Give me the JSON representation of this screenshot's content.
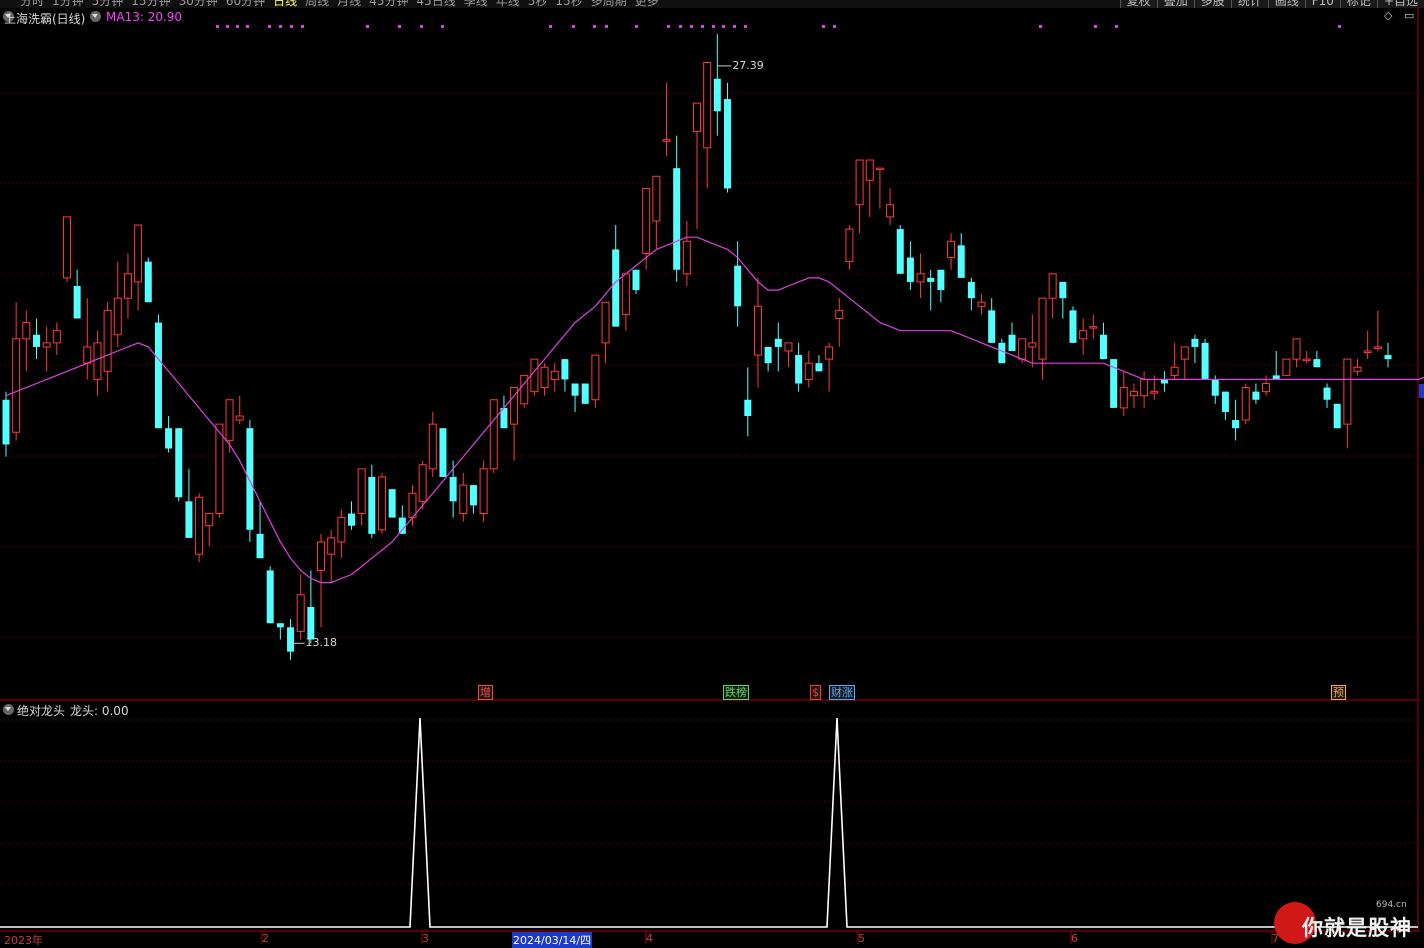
{
  "toolbar": {
    "period_tabs": [
      "分时",
      "1分钟",
      "5分钟",
      "15分钟",
      "30分钟",
      "60分钟",
      "日线",
      "周线",
      "月线",
      "45分钟",
      "45日线",
      "季线",
      "年线",
      "5秒",
      "15秒",
      "多周期",
      "更多"
    ],
    "active_tab": "日线",
    "right_buttons": [
      "复权",
      "叠加",
      "多股",
      "统计",
      "画线",
      "F10",
      "标记",
      "+自选"
    ]
  },
  "chart": {
    "symbol_title": "上海洗霸(日线)",
    "ma_label": "MA13: 20.90",
    "high_marker": "27.39",
    "low_marker": "13.18"
  },
  "signals": [
    {
      "label": "增",
      "color": "#ff4444"
    },
    {
      "label": "跌榜",
      "color": "#55dd55"
    },
    {
      "label": "$",
      "color": "#ff3333"
    },
    {
      "label": "财涨",
      "color": "#55aaff"
    },
    {
      "label": "预",
      "color": "#ffaa33"
    }
  ],
  "indicator": {
    "title": "绝对龙头",
    "value_label": "龙头: 0.00"
  },
  "dates": {
    "labels": [
      "2023年",
      "2",
      "3",
      "4",
      "5",
      "6",
      "7"
    ],
    "selected": "2024/03/14/四"
  },
  "watermark": {
    "text": "你就是股神",
    "small": "694.cn"
  },
  "colors": {
    "up": "#ff3a3a",
    "down": "#54ffff",
    "ma": "#e040e0",
    "grid": "#7a0000",
    "background": "#000000",
    "indicator": "#ffffff"
  },
  "chart_data": {
    "type": "candlestick",
    "title": "上海洗霸(日线)",
    "series_ma": {
      "name": "MA13",
      "last": 20.9
    },
    "ohlc": [
      [
        19.1,
        19.3,
        17.7,
        18.0
      ],
      [
        18.3,
        21.5,
        18.1,
        20.6
      ],
      [
        20.6,
        21.3,
        19.8,
        21.0
      ],
      [
        20.7,
        21.1,
        20.1,
        20.4
      ],
      [
        20.4,
        20.9,
        19.8,
        20.5
      ],
      [
        20.5,
        21.0,
        20.2,
        20.8
      ],
      [
        22.1,
        23.2,
        22.0,
        23.6
      ],
      [
        21.9,
        22.3,
        21.1,
        21.1
      ],
      [
        20.0,
        21.6,
        19.6,
        20.4
      ],
      [
        19.6,
        20.8,
        19.2,
        20.5
      ],
      [
        19.8,
        21.5,
        19.3,
        21.3
      ],
      [
        20.7,
        22.5,
        20.4,
        21.6
      ],
      [
        21.6,
        22.7,
        21.1,
        22.2
      ],
      [
        22.0,
        23.3,
        21.3,
        23.4
      ],
      [
        22.5,
        22.6,
        21.7,
        21.5
      ],
      [
        21.0,
        21.2,
        18.8,
        18.4
      ],
      [
        18.4,
        18.7,
        17.8,
        17.9
      ],
      [
        18.4,
        18.4,
        16.6,
        16.7
      ],
      [
        16.6,
        17.4,
        15.8,
        15.7
      ],
      [
        15.3,
        16.8,
        15.1,
        16.7
      ],
      [
        16.0,
        16.3,
        15.5,
        16.3
      ],
      [
        16.3,
        18.3,
        16.2,
        18.5
      ],
      [
        18.1,
        19.0,
        17.8,
        19.1
      ],
      [
        18.6,
        19.2,
        18.5,
        18.7
      ],
      [
        18.4,
        18.6,
        15.6,
        15.9
      ],
      [
        15.8,
        16.6,
        15.3,
        15.2
      ],
      [
        14.9,
        15.0,
        13.7,
        13.6
      ],
      [
        13.6,
        13.6,
        13.2,
        13.5
      ],
      [
        13.5,
        13.7,
        12.7,
        12.9
      ],
      [
        13.4,
        14.8,
        13.2,
        14.3
      ],
      [
        14.0,
        14.9,
        13.1,
        13.2
      ],
      [
        14.9,
        15.8,
        13.5,
        15.6
      ],
      [
        15.3,
        15.9,
        14.6,
        15.7
      ],
      [
        15.6,
        16.4,
        15.2,
        16.2
      ],
      [
        16.3,
        16.6,
        15.9,
        16.0
      ],
      [
        16.3,
        17.2,
        16.0,
        17.4
      ],
      [
        17.2,
        17.5,
        15.7,
        15.8
      ],
      [
        15.9,
        17.3,
        15.8,
        17.2
      ],
      [
        16.9,
        16.9,
        16.2,
        16.2
      ],
      [
        16.2,
        16.5,
        15.8,
        15.8
      ],
      [
        16.2,
        17.0,
        16.0,
        16.8
      ],
      [
        16.6,
        17.6,
        16.4,
        17.5
      ],
      [
        17.4,
        18.8,
        17.2,
        18.5
      ],
      [
        18.4,
        18.4,
        18.5,
        17.2
      ],
      [
        17.2,
        17.6,
        16.2,
        16.6
      ],
      [
        16.3,
        17.3,
        16.1,
        17.0
      ],
      [
        17.0,
        17.0,
        16.3,
        16.5
      ],
      [
        16.3,
        17.6,
        16.1,
        17.4
      ],
      [
        17.4,
        19.0,
        17.3,
        19.1
      ],
      [
        18.9,
        19.2,
        18.5,
        18.4
      ],
      [
        18.5,
        19.3,
        17.6,
        19.4
      ],
      [
        19.0,
        19.4,
        18.9,
        19.7
      ],
      [
        19.3,
        19.9,
        19.2,
        20.1
      ],
      [
        19.4,
        20.0,
        19.2,
        19.9
      ],
      [
        19.6,
        20.0,
        19.3,
        19.8
      ],
      [
        20.1,
        20.0,
        19.3,
        19.6
      ],
      [
        19.5,
        19.4,
        18.8,
        19.2
      ],
      [
        19.5,
        19.5,
        19.0,
        19.0
      ],
      [
        19.1,
        20.2,
        18.9,
        20.2
      ],
      [
        20.5,
        21.5,
        20.0,
        21.5
      ],
      [
        22.8,
        23.4,
        20.9,
        20.9
      ],
      [
        21.2,
        22.2,
        20.8,
        22.2
      ],
      [
        22.3,
        22.1,
        21.7,
        21.8
      ],
      [
        22.7,
        24.3,
        22.3,
        24.3
      ],
      [
        23.5,
        24.6,
        22.8,
        24.6
      ],
      [
        25.5,
        26.9,
        25.1,
        25.5
      ],
      [
        24.8,
        25.6,
        22.0,
        22.3
      ],
      [
        22.2,
        23.5,
        21.9,
        23.0
      ],
      [
        25.7,
        26.2,
        23.3,
        26.4
      ],
      [
        25.3,
        26.7,
        24.3,
        27.4
      ],
      [
        27.0,
        28.1,
        25.6,
        26.2
      ],
      [
        26.5,
        26.9,
        24.2,
        24.3
      ],
      [
        22.4,
        23.0,
        20.9,
        21.4
      ],
      [
        19.1,
        19.9,
        18.2,
        18.7
      ],
      [
        20.2,
        22.1,
        19.4,
        21.4
      ],
      [
        20.4,
        20.4,
        19.8,
        20.0
      ],
      [
        20.6,
        21.0,
        19.8,
        20.4
      ],
      [
        20.3,
        20.5,
        19.9,
        20.5
      ],
      [
        20.2,
        20.5,
        19.3,
        19.5
      ],
      [
        19.6,
        20.3,
        19.4,
        20.0
      ],
      [
        20.0,
        20.2,
        19.9,
        19.8
      ],
      [
        20.1,
        20.5,
        19.3,
        20.4
      ],
      [
        21.1,
        21.6,
        20.4,
        21.3
      ],
      [
        22.5,
        23.4,
        22.3,
        23.3
      ],
      [
        23.9,
        24.2,
        23.2,
        25.0
      ],
      [
        24.5,
        25.0,
        23.6,
        25.0
      ],
      [
        24.8,
        24.7,
        23.8,
        24.8
      ],
      [
        23.6,
        24.3,
        23.4,
        23.9
      ],
      [
        23.3,
        23.4,
        22.2,
        22.2
      ],
      [
        22.6,
        23.0,
        21.8,
        22.0
      ],
      [
        22.0,
        22.7,
        21.6,
        22.2
      ],
      [
        22.1,
        22.3,
        21.3,
        22.0
      ],
      [
        22.3,
        22.3,
        21.5,
        21.8
      ],
      [
        22.6,
        23.2,
        22.3,
        23.0
      ],
      [
        22.9,
        23.2,
        22.6,
        22.1
      ],
      [
        22.0,
        22.1,
        21.3,
        21.6
      ],
      [
        21.4,
        21.7,
        21.2,
        21.5
      ],
      [
        21.3,
        21.6,
        21.0,
        20.5
      ],
      [
        20.5,
        20.6,
        20.0,
        20.0
      ],
      [
        20.7,
        21.0,
        20.4,
        20.3
      ],
      [
        20.1,
        20.6,
        20.0,
        20.6
      ],
      [
        20.4,
        21.2,
        19.9,
        20.5
      ],
      [
        20.1,
        20.8,
        19.6,
        21.6
      ],
      [
        21.6,
        22.2,
        21.1,
        22.2
      ],
      [
        22.0,
        22.0,
        21.1,
        21.6
      ],
      [
        21.3,
        21.4,
        21.1,
        20.5
      ],
      [
        20.6,
        21.1,
        20.2,
        20.8
      ],
      [
        20.9,
        21.2,
        20.6,
        20.9
      ],
      [
        20.7,
        21.0,
        20.4,
        20.1
      ],
      [
        20.1,
        20.0,
        19.7,
        18.9
      ],
      [
        18.9,
        19.8,
        18.7,
        19.4
      ],
      [
        19.2,
        19.5,
        18.9,
        19.3
      ],
      [
        19.2,
        19.8,
        18.9,
        19.6
      ],
      [
        19.3,
        19.7,
        19.1,
        19.3
      ],
      [
        19.6,
        19.8,
        19.3,
        19.5
      ],
      [
        19.7,
        20.5,
        19.6,
        19.9
      ],
      [
        20.1,
        20.3,
        19.6,
        20.4
      ],
      [
        20.6,
        20.7,
        20.0,
        20.4
      ],
      [
        20.5,
        20.6,
        19.6,
        19.6
      ],
      [
        19.6,
        19.7,
        19.0,
        19.2
      ],
      [
        19.3,
        19.3,
        18.6,
        18.8
      ],
      [
        18.6,
        19.1,
        18.1,
        18.4
      ],
      [
        18.6,
        19.5,
        18.5,
        19.4
      ],
      [
        19.3,
        19.5,
        19.0,
        19.1
      ],
      [
        19.3,
        19.7,
        19.2,
        19.5
      ],
      [
        19.7,
        20.3,
        19.6,
        19.6
      ],
      [
        19.7,
        20.1,
        19.7,
        20.1
      ],
      [
        20.1,
        20.6,
        19.9,
        20.6
      ],
      [
        20.1,
        20.3,
        20.0,
        20.1
      ],
      [
        20.1,
        20.3,
        20.0,
        19.9
      ],
      [
        19.4,
        19.5,
        18.9,
        19.1
      ],
      [
        19.0,
        19.0,
        18.6,
        18.4
      ],
      [
        18.5,
        20.0,
        17.9,
        20.1
      ],
      [
        19.8,
        20.1,
        19.7,
        19.9
      ],
      [
        20.3,
        20.8,
        20.1,
        20.3
      ],
      [
        20.4,
        21.3,
        20.3,
        20.4
      ],
      [
        20.2,
        20.5,
        19.9,
        20.1
      ]
    ],
    "ma13_values": [
      19.2,
      19.3,
      19.4,
      19.5,
      19.6,
      19.7,
      19.8,
      19.9,
      20.0,
      20.1,
      20.2,
      20.3,
      20.4,
      20.5,
      20.4,
      20.1,
      19.8,
      19.5,
      19.2,
      18.9,
      18.6,
      18.3,
      18.0,
      17.6,
      17.1,
      16.6,
      16.1,
      15.6,
      15.2,
      14.9,
      14.7,
      14.6,
      14.6,
      14.7,
      14.8,
      15.0,
      15.2,
      15.4,
      15.6,
      15.9,
      16.2,
      16.5,
      16.8,
      17.1,
      17.4,
      17.7,
      18.0,
      18.3,
      18.6,
      18.9,
      19.2,
      19.5,
      19.8,
      20.1,
      20.4,
      20.7,
      21.0,
      21.2,
      21.4,
      21.7,
      22.0,
      22.2,
      22.4,
      22.6,
      22.8,
      22.9,
      23.0,
      23.1,
      23.1,
      23.0,
      22.9,
      22.8,
      22.6,
      22.3,
      22.0,
      21.8,
      21.8,
      21.9,
      22.0,
      22.1,
      22.1,
      22.0,
      21.8,
      21.6,
      21.4,
      21.2,
      21.0,
      20.9,
      20.8,
      20.8,
      20.8,
      20.8,
      20.8,
      20.8,
      20.7,
      20.6,
      20.5,
      20.4,
      20.3,
      20.2,
      20.1,
      20.0,
      20.0,
      20.0,
      20.0,
      20.0,
      20.0,
      20.0,
      20.0,
      19.9,
      19.8,
      19.7,
      19.6,
      19.6,
      19.6,
      19.6,
      19.6,
      19.6,
      19.6,
      19.6,
      19.6,
      19.6,
      19.6,
      19.6,
      19.6,
      19.6,
      19.6,
      19.6,
      19.6,
      19.6,
      19.6,
      19.6,
      19.6,
      19.6,
      19.6,
      19.6,
      19.6,
      19.6,
      19.6,
      19.6,
      19.7,
      19.8,
      19.9,
      20.0
    ],
    "indicator_series": {
      "name": "龙头",
      "peak_days": [
        40,
        79
      ],
      "peak_value": 1,
      "base_value": 0
    },
    "high": 27.39,
    "low": 13.18
  }
}
